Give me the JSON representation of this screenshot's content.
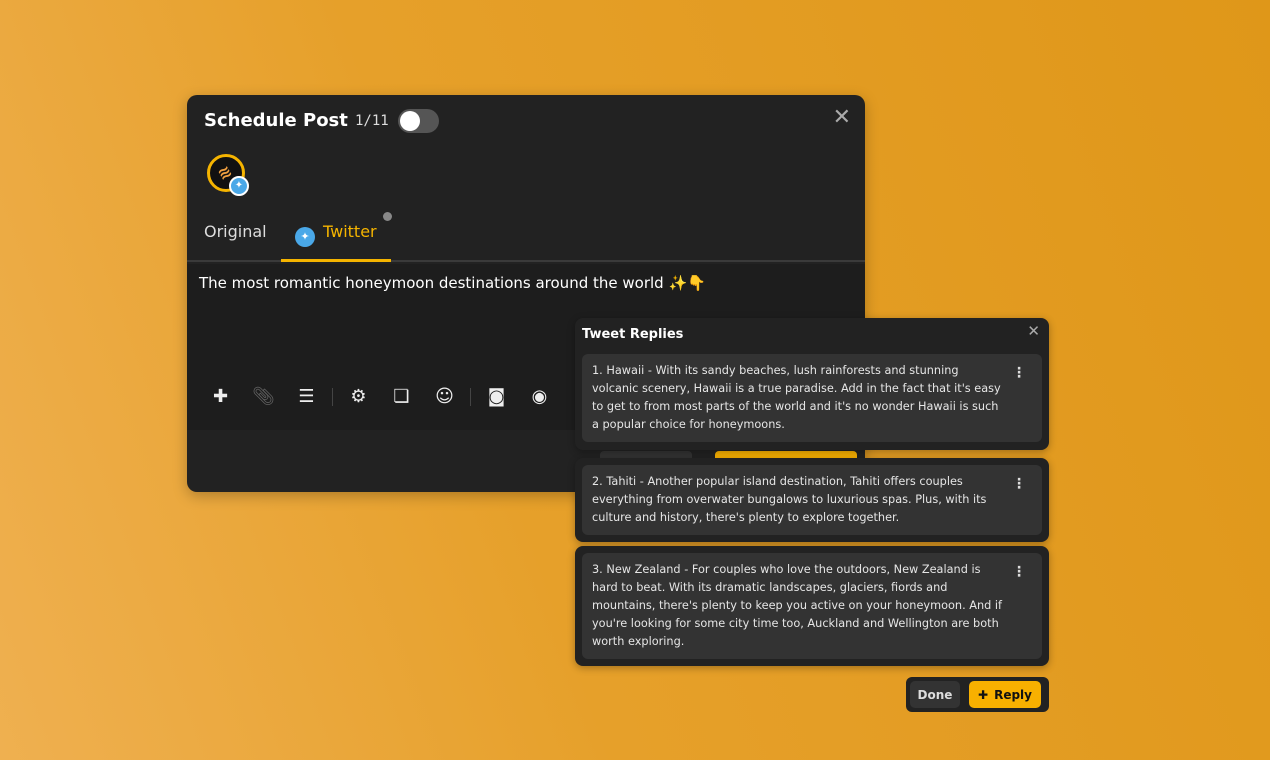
{
  "modal": {
    "title": "Schedule Post",
    "count": "1/11",
    "close": "✕",
    "tabs": [
      {
        "label": "Original"
      },
      {
        "label": "Twitter"
      }
    ],
    "text": "The most romantic honeymoon destinations around the world ✨👇",
    "toolbar": [
      "plus-icon",
      "attachment-icon",
      "align-icon",
      "robot-icon",
      "scroll-icon",
      "emoji-icon",
      "camera-icon",
      "eye-icon"
    ]
  },
  "replies": {
    "title": "Tweet Replies",
    "close": "✕",
    "items": [
      {
        "text": "1. Hawaii - With its sandy beaches, lush rainforests and stunning volcanic scenery, Hawaii is a true paradise. Add in the fact that it's easy to get to from most parts of the world and it's no wonder Hawaii is such a popular choice for honeymoons."
      },
      {
        "text": "2. Tahiti - Another popular island destination, Tahiti offers couples everything from overwater bungalows to luxurious spas. Plus, with its culture and history, there's plenty to explore together."
      },
      {
        "text": "3. New Zealand - For couples who love the outdoors, New Zealand is hard to beat. With its dramatic landscapes, glaciers, fiords and mountains, there's plenty to keep you active on your honeymoon. And if you're looking for some city time too, Auckland and Wellington are both worth exploring."
      }
    ],
    "done": "Done",
    "reply": "Reply"
  },
  "colors": {
    "accent": "#f8b000",
    "twitter": "#4aa8e8"
  }
}
